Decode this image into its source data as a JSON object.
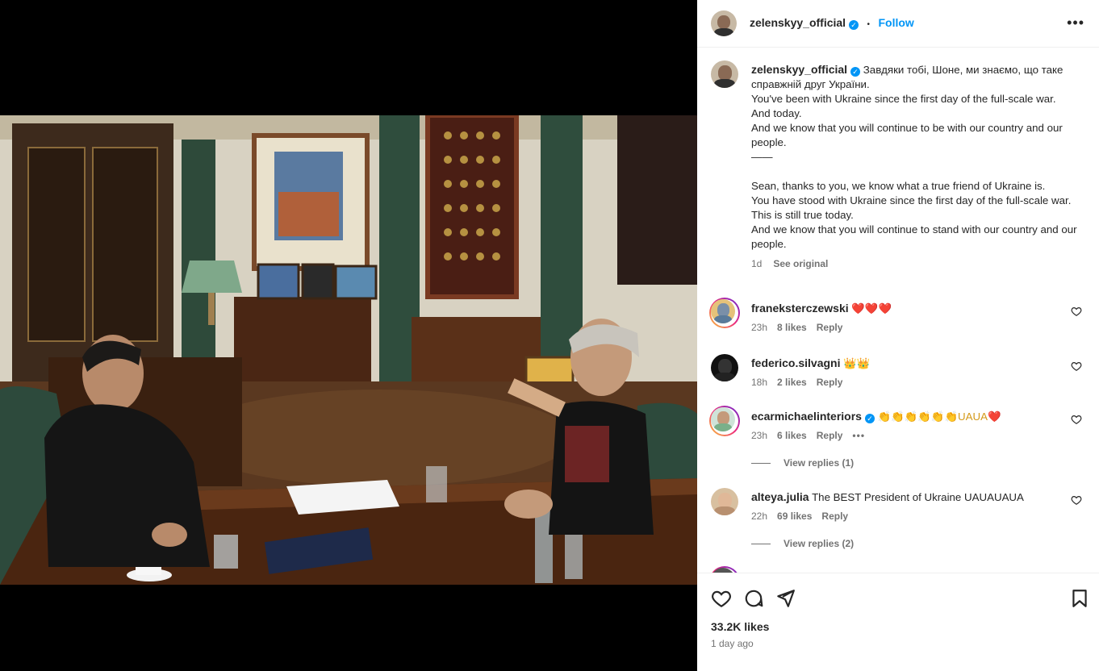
{
  "post": {
    "username": "zelenskyy_official",
    "follow_label": "Follow",
    "dot": "•",
    "more_label": "•••"
  },
  "caption": {
    "username": "zelenskyy_official",
    "lines": [
      "Завдяки тобі, Шоне, ми знаємо, що таке справжній друг України.",
      "You've been with Ukraine since the first day of the full-scale war.",
      "And today.",
      "And we know that you will continue to be with our country and our people.",
      "——",
      "",
      "Sean, thanks to you, we know what a true friend of Ukraine is.",
      "You have stood with Ukraine since the first day of the full-scale war.",
      "This is still true today.",
      "And we know that you will continue to stand with our country and our people."
    ],
    "time": "1d",
    "see_original": "See original"
  },
  "comments": [
    {
      "user": "franeksterczewski",
      "text": "❤️❤️❤️",
      "time": "23h",
      "likes": "8 likes",
      "reply": "Reply",
      "story_ring": true,
      "verified": false
    },
    {
      "user": "federico.silvagni",
      "text": "👑👑",
      "time": "18h",
      "likes": "2 likes",
      "reply": "Reply",
      "story_ring": false,
      "verified": false
    },
    {
      "user": "ecarmichaelinteriors",
      "text": "👏👏👏👏👏👏UAUA❤️",
      "time": "23h",
      "likes": "6 likes",
      "reply": "Reply",
      "story_ring": true,
      "verified": true,
      "more": "•••",
      "view_replies": "View replies (1)"
    },
    {
      "user": "alteya.julia",
      "text": "The BEST President of Ukraine UAUAUAUA",
      "time": "22h",
      "likes": "69 likes",
      "reply": "Reply",
      "story_ring": false,
      "verified": false,
      "view_replies": "View replies (2)"
    }
  ],
  "footer": {
    "likes": "33.2K likes",
    "ago": "1 day ago"
  },
  "icons": {
    "like": "heart-icon",
    "comment": "comment-icon",
    "share": "share-icon",
    "save": "bookmark-icon",
    "verified": "verified-badge-icon"
  },
  "colors": {
    "accent": "#0095f6",
    "muted": "#737373",
    "heart_red": "#ed4956"
  }
}
